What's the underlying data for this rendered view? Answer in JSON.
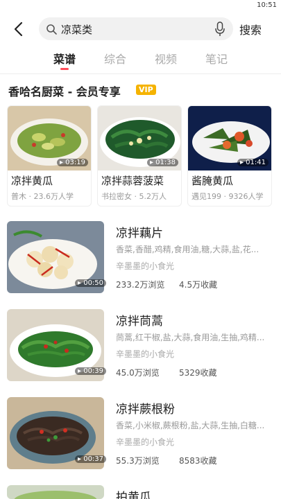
{
  "status": {
    "time": "10:51"
  },
  "search": {
    "query": "凉菜类",
    "button_label": "搜索"
  },
  "tabs": [
    {
      "label": "菜谱",
      "active": true
    },
    {
      "label": "综合",
      "active": false
    },
    {
      "label": "视频",
      "active": false
    },
    {
      "label": "笔记",
      "active": false
    }
  ],
  "section": {
    "title": "香哈名厨菜 - 会员专享",
    "badge": "VIP"
  },
  "cards": [
    {
      "title": "凉拌黄瓜",
      "meta": "普木 · 23.6万人学",
      "duration": "03:19"
    },
    {
      "title": "凉拌蒜蓉菠菜",
      "meta": "书拉密女 · 5.2万人",
      "duration": "01:38"
    },
    {
      "title": "酱腌黄瓜",
      "meta": "遇见199 · 9326人学",
      "duration": "01:41"
    }
  ],
  "recipes": [
    {
      "title": "凉拌藕片",
      "ingredients": "香菜,香醋,鸡精,食用油,糖,大蒜,盐,花...",
      "author": "辛墨墨的小食光",
      "views": "233.2万浏览",
      "favorites": "4.5万收藏",
      "duration": "00:50"
    },
    {
      "title": "凉拌茼蒿",
      "ingredients": "茼蒿,红干椒,盐,大蒜,食用油,生抽,鸡精...",
      "author": "辛墨墨的小食光",
      "views": "45.0万浏览",
      "favorites": "5329收藏",
      "duration": "00:39"
    },
    {
      "title": "凉拌蕨根粉",
      "ingredients": "香菜,小米椒,蕨根粉,盐,大蒜,生抽,白糖...",
      "author": "辛墨墨的小食光",
      "views": "55.3万浏览",
      "favorites": "8583收藏",
      "duration": "00:37"
    },
    {
      "title": "拍黄瓜"
    }
  ],
  "colors": {
    "accent": "#ff4d5a",
    "vip": "#f5b300"
  }
}
